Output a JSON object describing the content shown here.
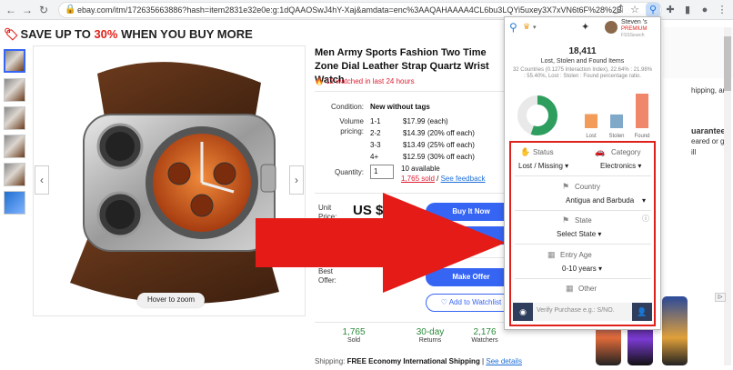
{
  "browser": {
    "url": "ebay.com/itm/172635663886?hash=item2831e32e0e:g:1dQAAOSwJ4hY-Xaj&amdata=enc%3AAQAHAAAA4CL6bu3LQYi5uxey3X7xVN6t6F%28%2BiAWgdH..."
  },
  "page": {
    "promo_prefix": "SAVE UP TO ",
    "promo_percent": "30%",
    "promo_suffix": " WHEN YOU BUY MORE",
    "title": "Men Army Sports Fashion Two Time Zone Dial Leather Strap Quartz Wrist Watch",
    "watched": "12 watched in last 24 hours",
    "condition_label": "Condition:",
    "condition_value": "New without tags",
    "volume_label": "Volume pricing:",
    "volume_tiers": [
      {
        "qty": "1-1",
        "price": "$17.99",
        "note": "(each)"
      },
      {
        "qty": "2-2",
        "price": "$14.39",
        "note": "(20% off each)"
      },
      {
        "qty": "3-3",
        "price": "$13.49",
        "note": "(25% off each)"
      },
      {
        "qty": "4+",
        "price": "$12.59",
        "note": "(30% off each)"
      }
    ],
    "quantity_label": "Quantity:",
    "quantity_value": "1",
    "available": "10 available",
    "sold_link": "1,765 sold",
    "feedback_link": "See feedback",
    "unit_price_label": "Unit Price:",
    "price": "US $17.99",
    "buy_now": "Buy It Now",
    "best_offer_label": "Best Offer:",
    "make_offer": "Make Offer",
    "add_watch": "♡ Add to Watchlist",
    "hover_zoom": "Hover to zoom",
    "stats": [
      {
        "num": "1,765",
        "label": "Sold"
      },
      {
        "num": "30-day",
        "label": "Returns"
      },
      {
        "num": "2,176",
        "label": "Watchers"
      }
    ],
    "shipping_label": "Shipping:",
    "shipping_value": "FREE Economy International Shipping",
    "see_details": "See details",
    "right_texts": [
      "hipping, and",
      "uarantee",
      "eared or get",
      "ill"
    ]
  },
  "extension": {
    "user_name": "Steven 's",
    "user_plan": "PREMIUM",
    "user_sub": "FSSSearch",
    "count": "18,411",
    "subtitle": "Lost, Stolen and Found Items",
    "description": "32 Countries (0.1275 Interaction Index), 22.64% : 21.98% : 55.40%, Lost : Stolen : Found percentage ratio.",
    "chart_data": {
      "type": "bar",
      "categories": [
        "Lost",
        "Stolen",
        "Found"
      ],
      "values": [
        22.64,
        21.98,
        55.4
      ]
    },
    "colors": {
      "lost": "#f39c5a",
      "stolen": "#7fa8c9",
      "found": "#f0876a",
      "donut": "#2e9e5e"
    },
    "filters": {
      "status_label": "Status",
      "status_value": "Lost / Missing",
      "category_label": "Category",
      "category_value": "Electronics",
      "country_label": "Country",
      "country_value": "Antigua and Barbuda",
      "state_label": "State",
      "state_value": "Select State",
      "age_label": "Entry  Age",
      "age_value": "0-10 years",
      "other_label": "Other",
      "verify_placeholder": "Verify Purchase e.g.: S/NO."
    }
  }
}
